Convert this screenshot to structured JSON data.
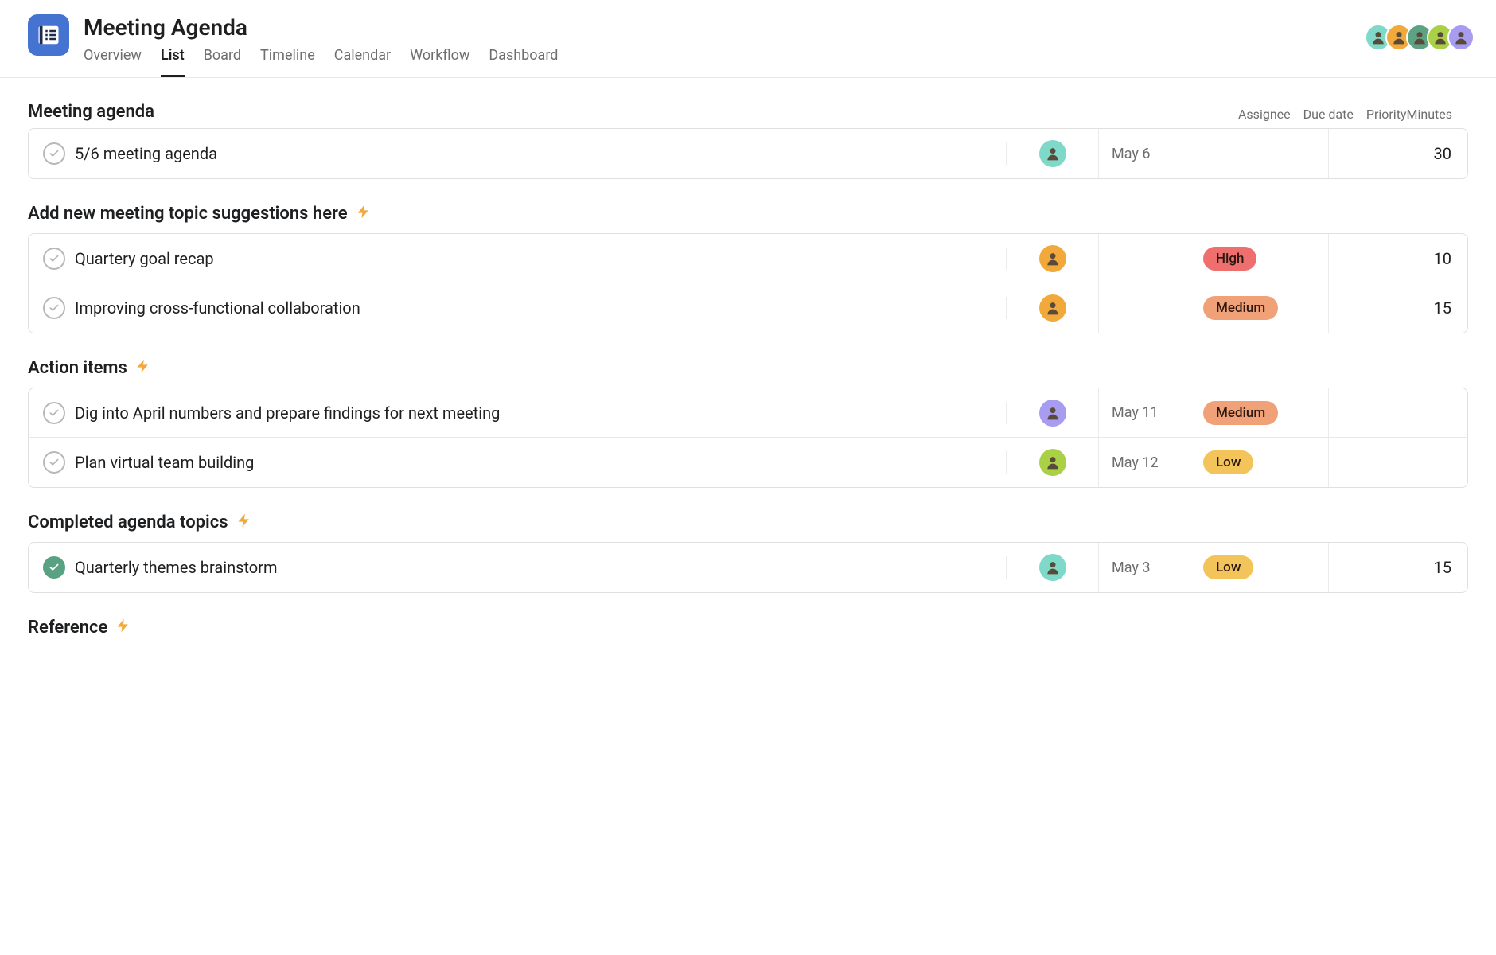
{
  "project": {
    "title": "Meeting Agenda",
    "tabs": [
      {
        "label": "Overview",
        "active": false
      },
      {
        "label": "List",
        "active": true
      },
      {
        "label": "Board",
        "active": false
      },
      {
        "label": "Timeline",
        "active": false
      },
      {
        "label": "Calendar",
        "active": false
      },
      {
        "label": "Workflow",
        "active": false
      },
      {
        "label": "Dashboard",
        "active": false
      }
    ]
  },
  "collaborators": [
    {
      "id": "u1",
      "color": "#7fd9c8"
    },
    {
      "id": "u2",
      "color": "#f2a93b"
    },
    {
      "id": "u3",
      "color": "#5da283"
    },
    {
      "id": "u4",
      "color": "#aad046"
    },
    {
      "id": "u5",
      "color": "#a89cf0"
    }
  ],
  "columns": {
    "assignee": "Assignee",
    "due_date": "Due date",
    "priority": "Priority",
    "minutes": "Minutes"
  },
  "priority_colors": {
    "High": "#ef6e6e",
    "Medium": "#f1a178",
    "Low": "#f2c45a"
  },
  "sections": [
    {
      "title": "Meeting agenda",
      "bolt": false,
      "show_headers": true,
      "tasks": [
        {
          "name": "5/6 meeting agenda",
          "done": false,
          "assignee_color": "#7fd9c8",
          "due": "May 6",
          "priority": "",
          "minutes": "30"
        }
      ]
    },
    {
      "title": "Add new meeting topic suggestions here",
      "bolt": true,
      "show_headers": false,
      "tasks": [
        {
          "name": "Quartery goal recap",
          "done": false,
          "assignee_color": "#f2a93b",
          "due": "",
          "priority": "High",
          "minutes": "10"
        },
        {
          "name": "Improving cross-functional collaboration",
          "done": false,
          "assignee_color": "#f2a93b",
          "due": "",
          "priority": "Medium",
          "minutes": "15"
        }
      ]
    },
    {
      "title": "Action items",
      "bolt": true,
      "show_headers": false,
      "tasks": [
        {
          "name": "Dig into April numbers and prepare findings for next meeting",
          "done": false,
          "assignee_color": "#a89cf0",
          "due": "May 11",
          "priority": "Medium",
          "minutes": ""
        },
        {
          "name": "Plan virtual team building",
          "done": false,
          "assignee_color": "#aad046",
          "due": "May 12",
          "priority": "Low",
          "minutes": ""
        }
      ]
    },
    {
      "title": "Completed agenda topics",
      "bolt": true,
      "show_headers": false,
      "tasks": [
        {
          "name": "Quarterly themes brainstorm",
          "done": true,
          "assignee_color": "#7fd9c8",
          "due": "May 3",
          "priority": "Low",
          "minutes": "15"
        }
      ]
    },
    {
      "title": "Reference",
      "bolt": true,
      "show_headers": false,
      "tasks": []
    }
  ]
}
